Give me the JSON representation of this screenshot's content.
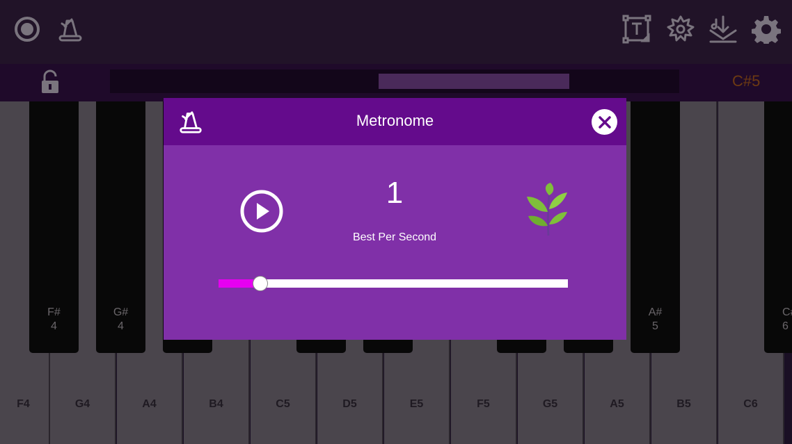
{
  "toolbar": {
    "left_icons": [
      "record-icon",
      "metronome-icon"
    ],
    "right_icons": [
      "text-label-icon",
      "sound-effect-icon",
      "download-song-icon",
      "gear-icon"
    ]
  },
  "strip": {
    "lock_icon": "unlocked-padlock-icon",
    "current_note": "C#5"
  },
  "keyboard": {
    "white_keys": [
      "F4",
      "G4",
      "A4",
      "B4",
      "C5",
      "D5",
      "E5",
      "F5",
      "G5",
      "A5",
      "B5",
      "C6"
    ],
    "black_keys": [
      {
        "note": "F#",
        "octave": "4"
      },
      {
        "note": "G#",
        "octave": "4"
      },
      {
        "note": "",
        "octave": ""
      },
      {
        "note": "",
        "octave": ""
      },
      {
        "note": "",
        "octave": ""
      },
      {
        "note": "",
        "octave": ""
      },
      {
        "note": "",
        "octave": ""
      },
      {
        "note": "A#",
        "octave": "5"
      },
      {
        "note": "C#",
        "octave": "6"
      }
    ]
  },
  "metronome_dialog": {
    "title": "Metronome",
    "header_icon": "metronome-icon",
    "close_icon": "close-icon",
    "play_icon": "play-icon",
    "value": "1",
    "unit_label": "Best Per Second",
    "decor_icon": "leaf-icon",
    "slider_fraction": 0.12
  },
  "colors": {
    "dialog_header": "#640b8c",
    "dialog_body": "#8030a8",
    "slider_fill": "#e600f0"
  }
}
